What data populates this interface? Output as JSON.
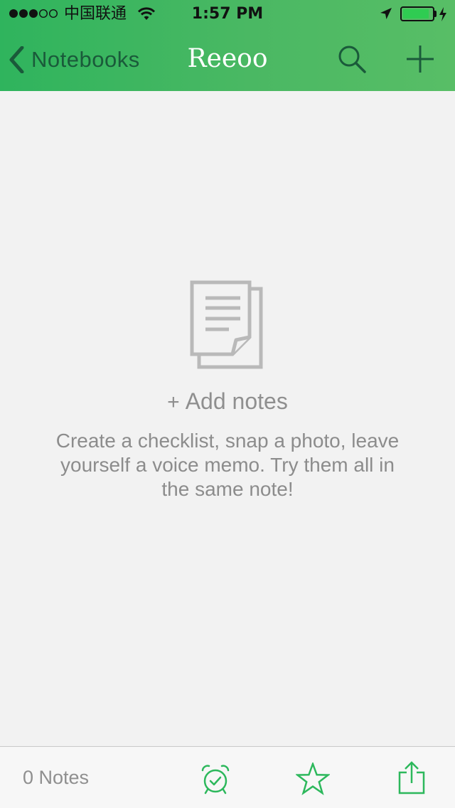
{
  "status_bar": {
    "carrier": "中国联通",
    "time": "1:57 PM",
    "battery_level": 0.9
  },
  "nav": {
    "back_label": "Notebooks",
    "title": "Reeoo"
  },
  "empty_state": {
    "add_plus": "+",
    "add_label": "Add notes",
    "description": "Create a checklist, snap a photo, leave yourself a voice memo. Try them all in the same note!"
  },
  "bottom_bar": {
    "note_count": "0 Notes"
  },
  "colors": {
    "header_green": "#2fb45d",
    "accent_green": "#2db85c",
    "nav_icon_dark_green": "#1a5a3a"
  },
  "icons": [
    "signal-icon",
    "wifi-icon",
    "location-icon",
    "battery-icon",
    "charging-icon",
    "chevron-left-icon",
    "search-icon",
    "plus-icon",
    "note-stack-icon",
    "alarm-clock-icon",
    "star-icon",
    "share-icon"
  ]
}
